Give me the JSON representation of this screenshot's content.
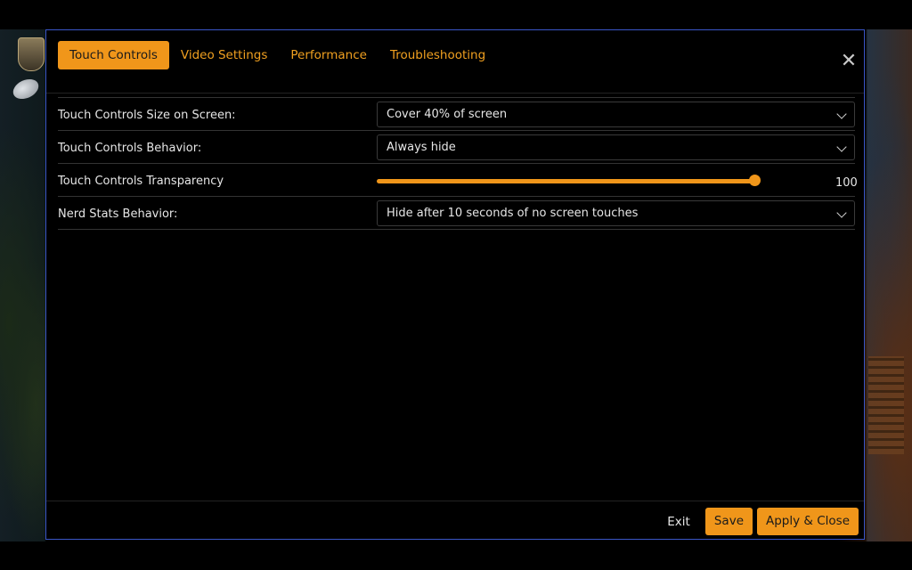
{
  "tabs": [
    {
      "label": "Touch Controls",
      "active": true
    },
    {
      "label": "Video Settings",
      "active": false
    },
    {
      "label": "Performance",
      "active": false
    },
    {
      "label": "Troubleshooting",
      "active": false
    }
  ],
  "close_symbol": "✕",
  "settings": {
    "size": {
      "label": "Touch Controls Size on Screen:",
      "value": "Cover 40% of screen"
    },
    "behavior": {
      "label": "Touch Controls Behavior:",
      "value": "Always hide"
    },
    "transparency": {
      "label": "Touch Controls Transparency",
      "value": "100",
      "fraction": 1.0
    },
    "nerd_stats": {
      "label": "Nerd Stats Behavior:",
      "value": "Hide after 10 seconds of no screen touches"
    }
  },
  "footer": {
    "exit": "Exit",
    "save": "Save",
    "apply_close": "Apply & Close"
  },
  "colors": {
    "accent": "#f0961a",
    "border": "#3a56c8"
  }
}
